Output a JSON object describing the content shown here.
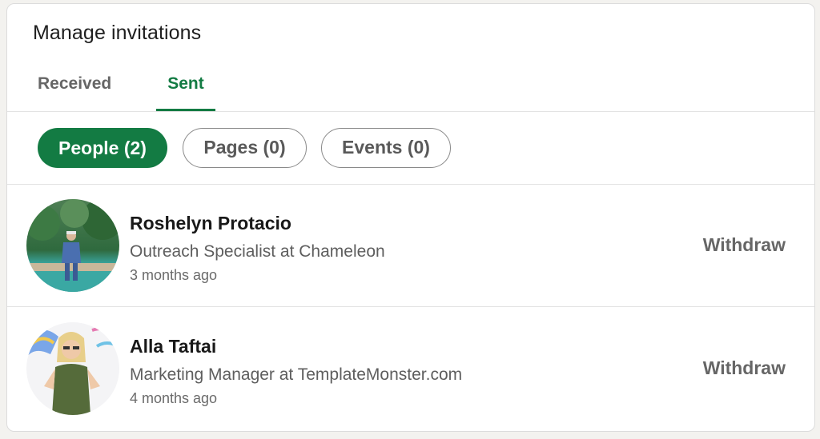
{
  "card": {
    "title": "Manage invitations"
  },
  "tabs": [
    {
      "label": "Received",
      "active": false
    },
    {
      "label": "Sent",
      "active": true
    }
  ],
  "filters": [
    {
      "label": "People (2)",
      "selected": true
    },
    {
      "label": "Pages (0)",
      "selected": false
    },
    {
      "label": "Events (0)",
      "selected": false
    }
  ],
  "invitations": [
    {
      "name": "Roshelyn Protacio",
      "headline": "Outreach Specialist at Chameleon",
      "time": "3 months ago",
      "action": "Withdraw"
    },
    {
      "name": "Alla Taftai",
      "headline": "Marketing Manager at TemplateMonster.com",
      "time": "4 months ago",
      "action": "Withdraw"
    }
  ],
  "colors": {
    "accent": "#137b43",
    "text_secondary": "#666666",
    "divider": "#e3e3e3"
  }
}
